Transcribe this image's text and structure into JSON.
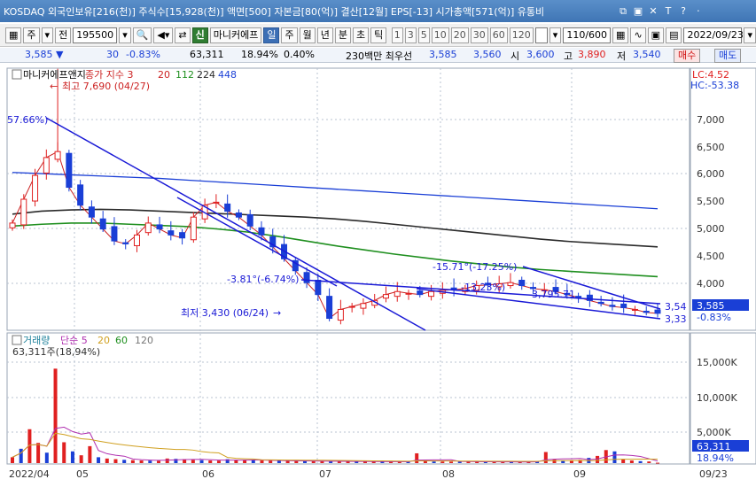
{
  "titlebar": {
    "text": "KOSDAQ 외국인보유[216(천)] 주식수[15,928(천)] 액면[500] 자본금[80(억)] 결산[12월] EPS[-13] 시가총액[571(억)] 유통비",
    "icons": [
      "⧉",
      "▣",
      "✕",
      "T",
      "?",
      "⋅"
    ]
  },
  "toolbar": {
    "market_btn": "주",
    "price_label": "전",
    "code_value": "195500",
    "name_btn": "마니커에프",
    "period_active": "일",
    "periods": [
      "주",
      "월",
      "년",
      "분",
      "초",
      "틱"
    ],
    "intervals": [
      "1",
      "3",
      "5",
      "10",
      "20",
      "30",
      "60",
      "120"
    ],
    "count_value": "110/600",
    "date_value": "2022/09/23"
  },
  "quote": {
    "price": "3,585 ▼",
    "change": "30",
    "change_pct": "-0.83%",
    "volume": "63,311",
    "turnover": "18.94%",
    "ratio": "0.40%",
    "priority_label": "230백만 최우선",
    "ask": "3,585",
    "bid": "3,560",
    "open_label": "시",
    "open": "3,600",
    "high_label": "고",
    "high": "3,890",
    "low_label": "저",
    "low": "3,540",
    "buy_btn": "매수",
    "sell_btn": "매도"
  },
  "colors": {
    "up": "#e02020",
    "down": "#1a3fd6",
    "ma3": "#cc2222",
    "ma20": "#2a2a2a",
    "ma112": "#1f8f1f",
    "ma224": "#1a3fd6",
    "trend": "#1a1ad6"
  },
  "legend": {
    "name": "마니커에프앤지",
    "close_label": "종가 지수 3",
    "ma_values": [
      "20",
      "112",
      "224",
      "448"
    ]
  },
  "annotations": {
    "high": "최고 7,690 (04/27)",
    "pct_left": "57.66%)",
    "low": "최저 3,430 (06/24)",
    "mid": "-3.81°(-6.74%)",
    "right_top": "-15.71°(-17.25%)",
    "right_mid": "-13.23%)",
    "right_low": "-3,795.71",
    "end1": "3,54",
    "end2": "3,33"
  },
  "price_axis": {
    "lc": "LC:4.52",
    "hc": "HC:-53.38",
    "ticks": [
      "7,000",
      "6,500",
      "6,000",
      "5,500",
      "5,000",
      "4,500",
      "4,000",
      "3,500"
    ],
    "current": "3,585",
    "current_pct": "-0.83%"
  },
  "volume_panel": {
    "legend_label": "거래량",
    "ma_label": "단순 5",
    "ma_values": [
      "20",
      "60",
      "120"
    ],
    "current_text": "63,311주(18,94%)",
    "ticks": [
      "15,000K",
      "10,000K",
      "5,000K"
    ],
    "current": "63,311",
    "current_pct": "18.94%"
  },
  "time_axis": {
    "labels": [
      "2022/04",
      "05",
      "06",
      "07",
      "08",
      "09",
      "09/23"
    ]
  },
  "chart_data": {
    "type": "candlestick",
    "ylim": [
      3300,
      7700
    ],
    "high_point": 7690,
    "low_point": 3430,
    "last_close": 3585,
    "close_series": [
      5100,
      5500,
      5900,
      6200,
      6300,
      5700,
      5400,
      5200,
      5000,
      4800,
      4750,
      4900,
      5100,
      5000,
      4900,
      4850,
      5200,
      5400,
      5450,
      5300,
      5200,
      5050,
      4900,
      4700,
      4500,
      4300,
      4100,
      3900,
      3500,
      3650,
      3700,
      3750,
      3800,
      3900,
      3950,
      3920,
      3900,
      3950,
      3970,
      3980,
      4000,
      4050,
      4060,
      4080,
      4100,
      4050,
      4000,
      3980,
      3950,
      3900,
      3850,
      3800,
      3750,
      3700,
      3680,
      3650,
      3600,
      3585
    ],
    "ma20": [
      5250,
      5300,
      5320,
      5330,
      5320,
      5300,
      5280,
      5260,
      5240,
      5220,
      5200,
      5170,
      5130,
      5080,
      5030,
      4980,
      4930,
      4880,
      4830,
      4790,
      4760,
      4730,
      4700
    ],
    "ma112": [
      5050,
      5080,
      5100,
      5100,
      5080,
      5060,
      5040,
      5000,
      4950,
      4880,
      4800,
      4720,
      4650,
      4580,
      4520,
      4460,
      4410,
      4360,
      4320,
      4290,
      4260,
      4230,
      4200
    ],
    "ma224": [
      5950,
      5930,
      5910,
      5890,
      5870,
      5850,
      5820,
      5790,
      5760,
      5730,
      5700,
      5670,
      5640,
      5610,
      5580,
      5550,
      5520,
      5490,
      5460,
      5430,
      5400,
      5370,
      5340
    ],
    "volume": [
      900,
      2200,
      5200,
      3100,
      1600,
      14500,
      3200,
      1800,
      1200,
      2600,
      900,
      700,
      600,
      500,
      450,
      400,
      380,
      360,
      700,
      650,
      600,
      500,
      450,
      400,
      380,
      600,
      500,
      450,
      420,
      400,
      380,
      360,
      340,
      320,
      300,
      290,
      280,
      270,
      260,
      250,
      240,
      230,
      220,
      220,
      210,
      200,
      200,
      1500,
      300,
      250,
      240,
      230,
      220,
      210,
      200,
      190,
      180,
      170,
      160,
      150,
      200,
      300,
      1700,
      600,
      400,
      350,
      500,
      800,
      1100,
      2000,
      1800,
      600,
      400,
      300,
      250,
      63
    ]
  }
}
